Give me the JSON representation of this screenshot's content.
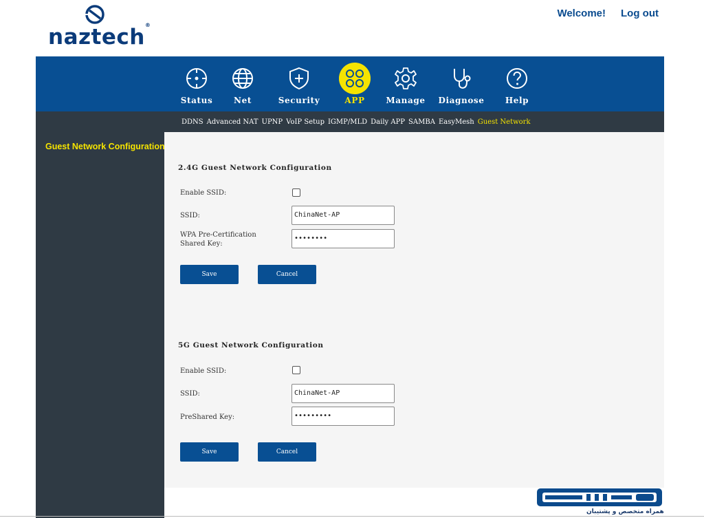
{
  "brand": {
    "name": "naztech",
    "reg": "®"
  },
  "top_links": {
    "welcome": "Welcome!",
    "logout": "Log out"
  },
  "nav": [
    {
      "label": "Status",
      "icon": "crosshair-icon"
    },
    {
      "label": "Net",
      "icon": "globe-icon"
    },
    {
      "label": "Security",
      "icon": "shield-plus-icon"
    },
    {
      "label": "APP",
      "icon": "apps-grid-icon",
      "active": true
    },
    {
      "label": "Manage",
      "icon": "gear-icon"
    },
    {
      "label": "Diagnose",
      "icon": "stethoscope-icon"
    },
    {
      "label": "Help",
      "icon": "question-icon"
    }
  ],
  "subnav": [
    "DDNS",
    "Advanced NAT",
    "UPNP",
    "VoIP Setup",
    "IGMP/MLD",
    "Daily APP",
    "SAMBA",
    "EasyMesh",
    "Guest Network"
  ],
  "sidebar": {
    "active_item": "Guest Network Configuration"
  },
  "section_24": {
    "title": "2.4G Guest Network Configuration",
    "enable_label": "Enable SSID:",
    "enable_checked": false,
    "ssid_label": "SSID:",
    "ssid_value": "ChinaNet-AP",
    "key_label_line1": "WPA Pre-Certification",
    "key_label_line2": "Shared Key:",
    "key_value": "••••••••",
    "save": "Save",
    "cancel": "Cancel"
  },
  "section_5": {
    "title": "5G Guest Network Configuration",
    "enable_label": "Enable SSID:",
    "enable_checked": false,
    "ssid_label": "SSID:",
    "ssid_value": "ChinaNet-AP",
    "key_label": "PreShared Key:",
    "key_value": "•••••••••",
    "save": "Save",
    "cancel": "Cancel"
  },
  "footer": {
    "tagline": "همراه متخصص و پشتیبان"
  },
  "colors": {
    "nav_blue": "#084f93",
    "dark_panel": "#2f3a44",
    "accent_yellow": "#f5e300"
  }
}
